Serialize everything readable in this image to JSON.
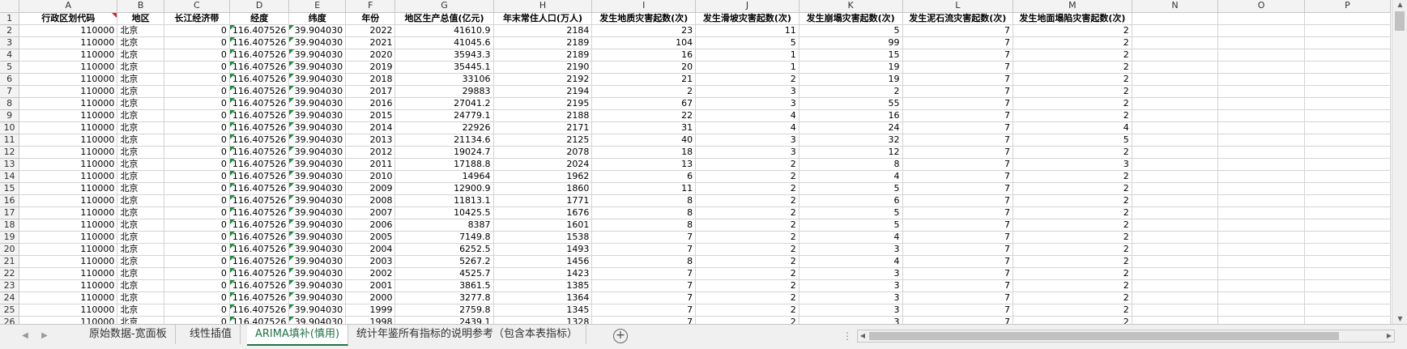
{
  "columns": [
    "A",
    "B",
    "C",
    "D",
    "E",
    "F",
    "G",
    "H",
    "I",
    "J",
    "K",
    "L",
    "M",
    "N",
    "O",
    "P"
  ],
  "header_row": [
    "行政区划代码",
    "地区",
    "长江经济带",
    "经度",
    "纬度",
    "年份",
    "地区生产总值(亿元)",
    "年末常住人口(万人)",
    "发生地质灾害起数(次)",
    "发生滑坡灾害起数(次)",
    "发生崩塌灾害起数(次)",
    "发生泥石流灾害起数(次)",
    "发生地面塌陷灾害起数(次)",
    "",
    "",
    ""
  ],
  "rows": [
    [
      "110000",
      "北京",
      "0",
      "116.407526",
      "39.904030",
      "2022",
      "41610.9",
      "2184",
      "23",
      "11",
      "5",
      "7",
      "2"
    ],
    [
      "110000",
      "北京",
      "0",
      "116.407526",
      "39.904030",
      "2021",
      "41045.6",
      "2189",
      "104",
      "5",
      "99",
      "7",
      "2"
    ],
    [
      "110000",
      "北京",
      "0",
      "116.407526",
      "39.904030",
      "2020",
      "35943.3",
      "2189",
      "16",
      "1",
      "15",
      "7",
      "2"
    ],
    [
      "110000",
      "北京",
      "0",
      "116.407526",
      "39.904030",
      "2019",
      "35445.1",
      "2190",
      "20",
      "1",
      "19",
      "7",
      "2"
    ],
    [
      "110000",
      "北京",
      "0",
      "116.407526",
      "39.904030",
      "2018",
      "33106",
      "2192",
      "21",
      "2",
      "19",
      "7",
      "2"
    ],
    [
      "110000",
      "北京",
      "0",
      "116.407526",
      "39.904030",
      "2017",
      "29883",
      "2194",
      "2",
      "3",
      "2",
      "7",
      "2"
    ],
    [
      "110000",
      "北京",
      "0",
      "116.407526",
      "39.904030",
      "2016",
      "27041.2",
      "2195",
      "67",
      "3",
      "55",
      "7",
      "2"
    ],
    [
      "110000",
      "北京",
      "0",
      "116.407526",
      "39.904030",
      "2015",
      "24779.1",
      "2188",
      "22",
      "4",
      "16",
      "7",
      "2"
    ],
    [
      "110000",
      "北京",
      "0",
      "116.407526",
      "39.904030",
      "2014",
      "22926",
      "2171",
      "31",
      "4",
      "24",
      "7",
      "4"
    ],
    [
      "110000",
      "北京",
      "0",
      "116.407526",
      "39.904030",
      "2013",
      "21134.6",
      "2125",
      "40",
      "3",
      "32",
      "7",
      "5"
    ],
    [
      "110000",
      "北京",
      "0",
      "116.407526",
      "39.904030",
      "2012",
      "19024.7",
      "2078",
      "18",
      "3",
      "12",
      "7",
      "2"
    ],
    [
      "110000",
      "北京",
      "0",
      "116.407526",
      "39.904030",
      "2011",
      "17188.8",
      "2024",
      "13",
      "2",
      "8",
      "7",
      "3"
    ],
    [
      "110000",
      "北京",
      "0",
      "116.407526",
      "39.904030",
      "2010",
      "14964",
      "1962",
      "6",
      "2",
      "4",
      "7",
      "2"
    ],
    [
      "110000",
      "北京",
      "0",
      "116.407526",
      "39.904030",
      "2009",
      "12900.9",
      "1860",
      "11",
      "2",
      "5",
      "7",
      "2"
    ],
    [
      "110000",
      "北京",
      "0",
      "116.407526",
      "39.904030",
      "2008",
      "11813.1",
      "1771",
      "8",
      "2",
      "6",
      "7",
      "2"
    ],
    [
      "110000",
      "北京",
      "0",
      "116.407526",
      "39.904030",
      "2007",
      "10425.5",
      "1676",
      "8",
      "2",
      "5",
      "7",
      "2"
    ],
    [
      "110000",
      "北京",
      "0",
      "116.407526",
      "39.904030",
      "2006",
      "8387",
      "1601",
      "8",
      "2",
      "5",
      "7",
      "2"
    ],
    [
      "110000",
      "北京",
      "0",
      "116.407526",
      "39.904030",
      "2005",
      "7149.8",
      "1538",
      "7",
      "2",
      "4",
      "7",
      "2"
    ],
    [
      "110000",
      "北京",
      "0",
      "116.407526",
      "39.904030",
      "2004",
      "6252.5",
      "1493",
      "7",
      "2",
      "3",
      "7",
      "2"
    ],
    [
      "110000",
      "北京",
      "0",
      "116.407526",
      "39.904030",
      "2003",
      "5267.2",
      "1456",
      "8",
      "2",
      "4",
      "7",
      "2"
    ],
    [
      "110000",
      "北京",
      "0",
      "116.407526",
      "39.904030",
      "2002",
      "4525.7",
      "1423",
      "7",
      "2",
      "3",
      "7",
      "2"
    ],
    [
      "110000",
      "北京",
      "0",
      "116.407526",
      "39.904030",
      "2001",
      "3861.5",
      "1385",
      "7",
      "2",
      "3",
      "7",
      "2"
    ],
    [
      "110000",
      "北京",
      "0",
      "116.407526",
      "39.904030",
      "2000",
      "3277.8",
      "1364",
      "7",
      "2",
      "3",
      "7",
      "2"
    ],
    [
      "110000",
      "北京",
      "0",
      "116.407526",
      "39.904030",
      "1999",
      "2759.8",
      "1345",
      "7",
      "2",
      "3",
      "7",
      "2"
    ],
    [
      "110000",
      "北京",
      "0",
      "116.407526",
      "39.904030",
      "1998",
      "2439.1",
      "1328",
      "7",
      "2",
      "3",
      "7",
      "2"
    ]
  ],
  "sheet_tabs": [
    {
      "label": "原始数据-宽面板",
      "active": false
    },
    {
      "label": "线性插值",
      "active": false
    },
    {
      "label": "ARIMA填补(慎用)",
      "active": true
    },
    {
      "label": "统计年鉴所有指标的说明参考（包含本表指标）",
      "active": false
    }
  ],
  "nav": {
    "prev": "◀",
    "next": "▶",
    "add": "+",
    "more": "⋮"
  },
  "colors": {
    "accent": "#217346",
    "green_marker": "#1e8c3a",
    "red_marker": "#dd2222"
  }
}
